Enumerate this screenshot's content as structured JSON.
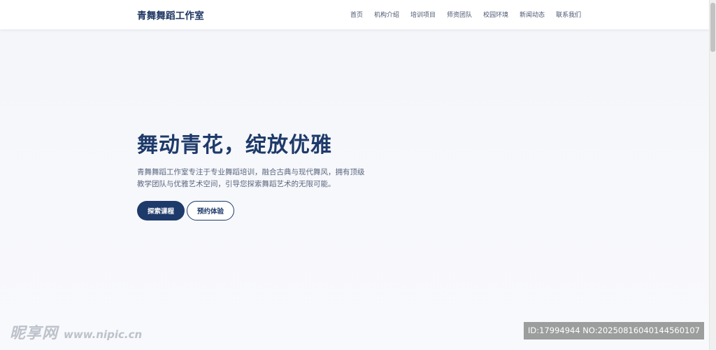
{
  "brand": {
    "name": "青舞舞蹈工作室"
  },
  "nav": {
    "items": [
      {
        "label": "首页"
      },
      {
        "label": "机构介绍"
      },
      {
        "label": "培训项目"
      },
      {
        "label": "师资团队"
      },
      {
        "label": "校园环境"
      },
      {
        "label": "新闻动态"
      },
      {
        "label": "联系我们"
      }
    ]
  },
  "hero": {
    "title": "舞动青花，绽放优雅",
    "description": "青舞舞蹈工作室专注于专业舞蹈培训，融合古典与现代舞风，拥有顶级教学团队与优雅艺术空间，引导您探索舞蹈艺术的无限可能。",
    "primary_button": "探索课程",
    "secondary_button": "预约体验"
  },
  "watermark": {
    "logo_text": "昵享网",
    "url": "www.nipic.cn",
    "id_text": "ID:17994944 NO:20250816040144560107"
  },
  "colors": {
    "accent": "#1e3a6a",
    "background": "#f5f7fa",
    "text_muted": "#5b6680"
  }
}
